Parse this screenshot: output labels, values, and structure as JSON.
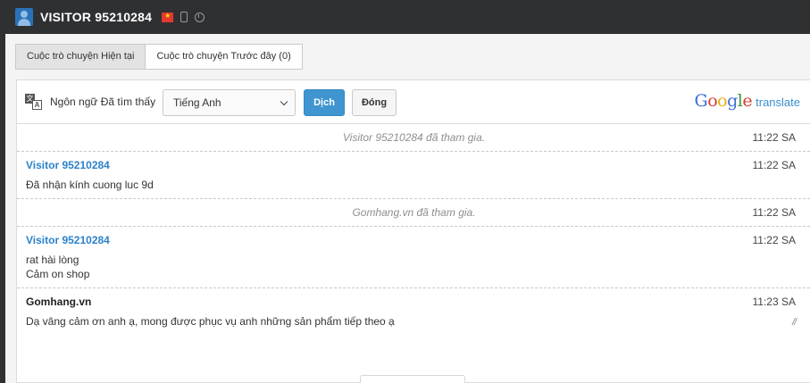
{
  "header": {
    "visitor_title": "VISITOR 95210284"
  },
  "tabs": [
    {
      "label": "Cuộc trò chuyện Hiện tại"
    },
    {
      "label": "Cuộc trò chuyện Trước đây (0)"
    }
  ],
  "translate": {
    "detected_label": "Ngôn ngữ Đã tìm thấy",
    "selected_language": "Tiếng Anh",
    "translate_button": "Dịch",
    "close_button": "Đóng",
    "provider_translate_word": "translate"
  },
  "messages": [
    {
      "type": "system",
      "text": "Visitor 95210284 đã tham gia.",
      "time": "11:22 SA"
    },
    {
      "type": "visitor",
      "author": "Visitor 95210284",
      "lines": [
        "Đã nhận kính cuong luc 9d"
      ],
      "time": "11:22 SA"
    },
    {
      "type": "system",
      "text": "Gomhang.vn đã tham gia.",
      "time": "11:22 SA"
    },
    {
      "type": "visitor",
      "author": "Visitor 95210284",
      "lines": [
        "rat hài lòng",
        "Cảm on shop"
      ],
      "time": "11:22 SA"
    },
    {
      "type": "agent",
      "author": "Gomhang.vn",
      "lines": [
        "Dạ vâng cảm ơn anh ạ, mong được phục vụ anh những sản phẩm tiếp theo ạ"
      ],
      "time": "11:23 SA"
    }
  ],
  "colors": {
    "topbar": "#2f3032",
    "accent_blue": "#3f95d0",
    "visitor_name": "#2b82c9"
  }
}
